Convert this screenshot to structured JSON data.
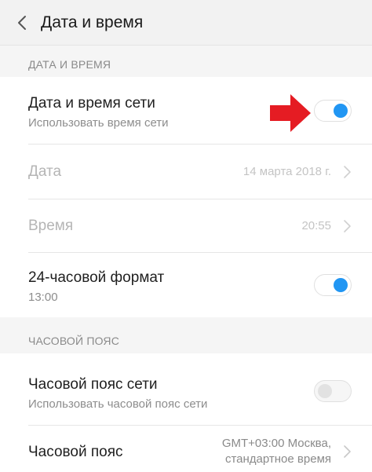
{
  "header": {
    "title": "Дата и время"
  },
  "sections": {
    "datetime": {
      "label": "ДАТА И ВРЕМЯ",
      "network_time": {
        "title": "Дата и время сети",
        "subtitle": "Использовать время сети",
        "enabled": true
      },
      "date": {
        "title": "Дата",
        "value": "14 марта 2018 г."
      },
      "time": {
        "title": "Время",
        "value": "20:55"
      },
      "format24": {
        "title": "24-часовой формат",
        "subtitle": "13:00",
        "enabled": true
      }
    },
    "timezone": {
      "label": "ЧАСОВОЙ ПОЯС",
      "network_timezone": {
        "title": "Часовой пояс сети",
        "subtitle": "Использовать часовой пояс сети",
        "enabled": false
      },
      "zone": {
        "title": "Часовой пояс",
        "value_line1": "GMT+03:00 Москва,",
        "value_line2": "стандартное время"
      }
    }
  },
  "colors": {
    "toggle_on": "#2196f3",
    "annotation_arrow": "#e51c23",
    "header_bg": "#f2f2f2"
  },
  "icons": {
    "back": "chevron-left-icon",
    "chevron": "chevron-right-icon",
    "annotation": "red-arrow-icon"
  }
}
